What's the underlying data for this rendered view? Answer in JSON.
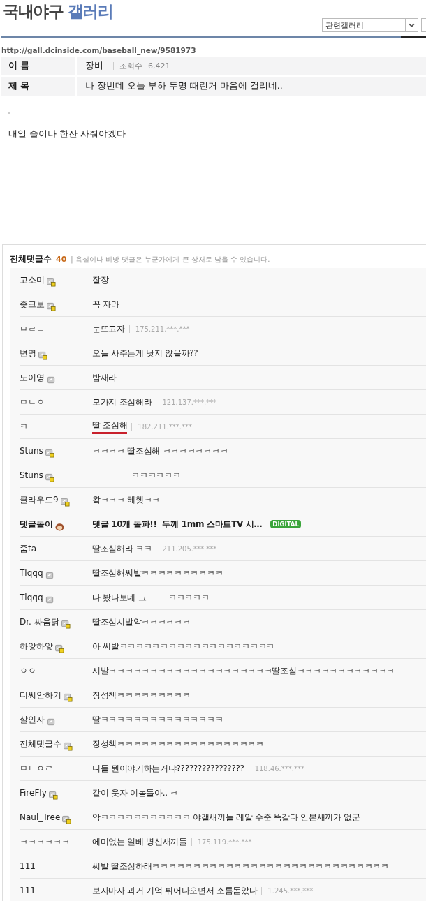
{
  "gallery": {
    "title": "국내야구",
    "title_accent": "갤러리",
    "related_select": "관련갤러리"
  },
  "url": "http://gall.dcinside.com/baseball_new/9581973",
  "post": {
    "name_label": "이 름",
    "author": "장비",
    "views_label": "조회수",
    "views": "6,421",
    "subject_label": "제 목",
    "subject": "나 장빈데 오늘 부하 두명 때린거 마음에 걸리네..",
    "body": "내일 술이나 한잔 사줘야겠다"
  },
  "comments": {
    "count_label": "전체댓글수",
    "count": "40",
    "notice": "| 욕설이나 비방 댓글은 누군가에게 큰 상처로 남을 수 있습니다.",
    "items": [
      {
        "name": "고소미",
        "kind": "member",
        "text": "잘장"
      },
      {
        "name": "좆크보",
        "kind": "member",
        "text": "꼭 자라"
      },
      {
        "name": "ㅁㄹㄷ",
        "kind": "guest",
        "text": "눈뜨고자",
        "ip": "175.211.***.***"
      },
      {
        "name": "변명",
        "kind": "member",
        "text": "오늘 사주는게 낫지 않을까??"
      },
      {
        "name": "노이영",
        "kind": "basic",
        "text": "밤새라"
      },
      {
        "name": "ㅁㄴㅇ",
        "kind": "guest",
        "text": "모가지 조심해라",
        "ip": "121.137.***.***"
      },
      {
        "name": "ㅋ",
        "kind": "guest",
        "text": "딸 조심해",
        "ip": "182.211.***.***",
        "underlined": true
      },
      {
        "name": "Stuns",
        "kind": "member",
        "text": "ㅋㅋㅋㅋ 딸조심해 ㅋㅋㅋㅋㅋㅋㅋㅋ"
      },
      {
        "name": "Stuns",
        "kind": "member",
        "text": "                ㅋㅋㅋㅋㅋㅋ"
      },
      {
        "name": "클라우드9",
        "kind": "member",
        "text": "왘ㅋㅋㅋ 헤헷ㅋㅋ"
      },
      {
        "name": "댓글돌이",
        "kind": "bot",
        "text": "댓글 10개 돌파!!  두께 1mm 스마트TV 시…",
        "badge": "DIGITAL"
      },
      {
        "name": "줌ta",
        "kind": "guest",
        "text": "딸조심해라 ㅋㅋ",
        "ip": "211.205.***.***"
      },
      {
        "name": "Tlqqq",
        "kind": "basic",
        "text": "딸조심해씨발ㅋㅋㅋㅋㅋㅋㅋㅋㅋㅋ"
      },
      {
        "name": "Tlqqq",
        "kind": "basic",
        "text": "다 봤나보네 그         ㅋㅋㅋㅋㅋ"
      },
      {
        "name": "Dr. 싸움닭",
        "kind": "member",
        "text": "딸조심시발악ㅋㅋㅋㅋㅋㅋ"
      },
      {
        "name": "하앟하앟",
        "kind": "member",
        "text": "아 씨발ㅋㅋㅋㅋㅋㅋㅋㅋㅋㅋㅋㅋㅋㅋㅋㅋㅋㅋㅋ"
      },
      {
        "name": "ㅇㅇ",
        "kind": "guest",
        "text": "시발ㅋㅋㅋㅋㅋㅋㅋㅋㅋㅋㅋㅋㅋㅋㅋㅋㅋㅋㅋㅋ딸조심ㅋㅋㅋㅋㅋㅋㅋㅋㅋㅋㅋㅋ"
      },
      {
        "name": "디씨안하기",
        "kind": "member",
        "text": "장성책ㅋㅋㅋㅋㅋㅋㅋㅋㅋ"
      },
      {
        "name": "살인자",
        "kind": "basic",
        "text": "딸ㅋㅋㅋㅋㅋㅋㅋㅋㅋㅋㅋㅋㅋㅋㅋ"
      },
      {
        "name": "전체댓글수",
        "kind": "member",
        "text": "장성책ㅋㅋㅋㅋㅋㅋㅋㅋㅋㅋㅋㅋㅋㅋㅋㅋㅋㅋ"
      },
      {
        "name": "ㅁㄴㅇㄹ",
        "kind": "guest",
        "text": "니들 뭔이야기하는거냐????????????????",
        "ip": "118.46.***.***"
      },
      {
        "name": "FireFly",
        "kind": "member",
        "text": "같이 웃자 이놈들아.. ㅋ"
      },
      {
        "name": "Naul_Tree",
        "kind": "member",
        "text": "악ㅋㅋㅋㅋㅋㅋㅋㅋㅋㅋㅋ 야갤새끼들 레알 수준 똑같다 안본새끼가 없군"
      },
      {
        "name": "ㅋㅋㅋㅋㅋㅋ",
        "kind": "guest",
        "text": "에미없는 일베 병신새끼들",
        "ip": "175.119.***.***"
      },
      {
        "name": "111",
        "kind": "guest",
        "text": "씨발 딸조심하래ㅋㅋㅋㅋㅋㅋㅋㅋㅋㅋㅋㅋㅋㅋㅋㅋㅋㅋㅋㅋㅋㅋㅋㅋㅋㅋㅋㅋㅋ"
      },
      {
        "name": "111",
        "kind": "guest",
        "text": "보자마자 과거 기억 튀어나오면서 소름돋았다",
        "ip": "1.245.***.***"
      }
    ]
  }
}
